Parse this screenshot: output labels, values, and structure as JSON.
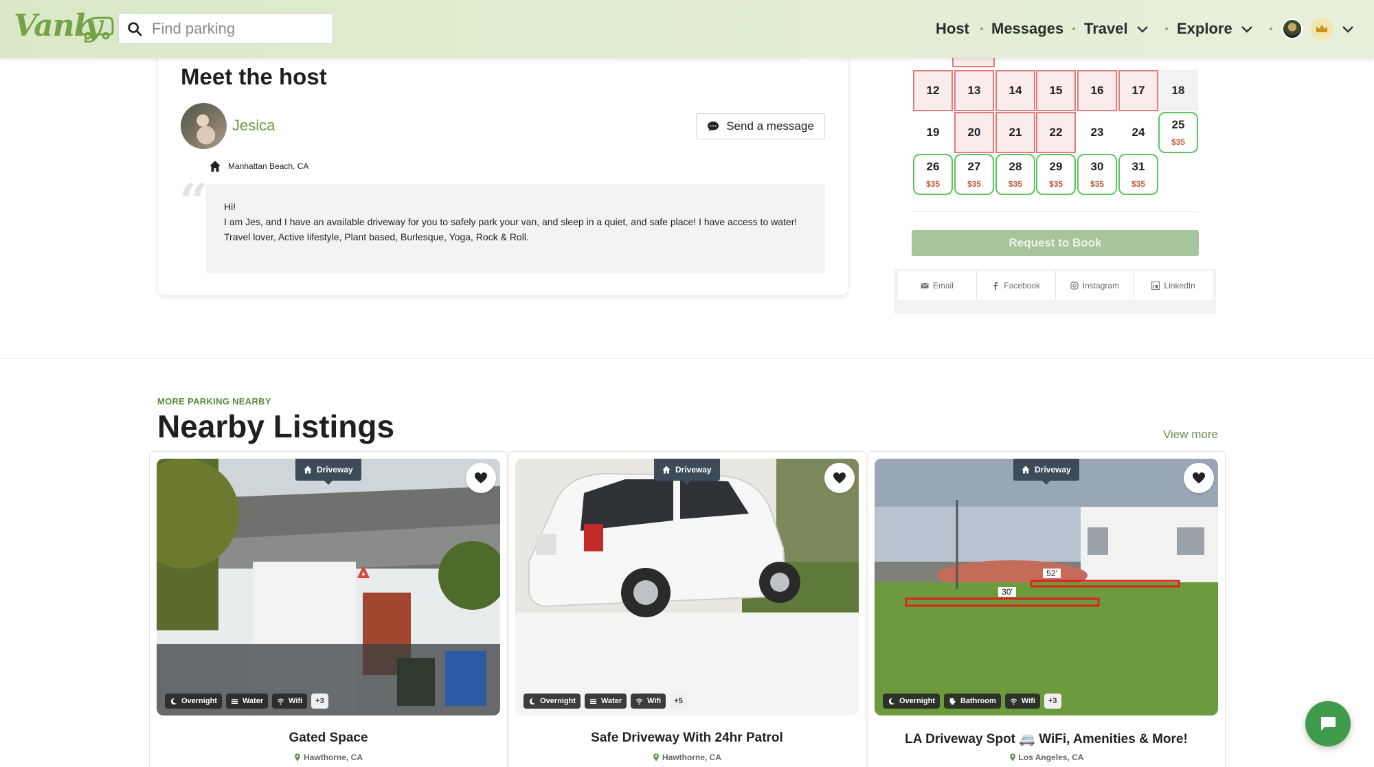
{
  "header": {
    "logo_text": "Vanly",
    "search_placeholder": "Find parking",
    "nav": {
      "host": "Host",
      "messages": "Messages",
      "travel": "Travel",
      "explore": "Explore"
    }
  },
  "host": {
    "title": "Meet the host",
    "name": "Jesica",
    "send_message": "Send a message",
    "location": "Manhattan Beach, CA",
    "bio": [
      "Hi!",
      "I am Jes, and I have an available driveway for you to safely park your van, and sleep in a quiet, and safe place! I have access to water!",
      "Travel lover, Active lifestyle, Plant based, Burlesque, Yoga, Rock & Roll."
    ]
  },
  "calendar": {
    "rows": [
      [
        {
          "d": "12",
          "s": "booked"
        },
        {
          "d": "13",
          "s": "booked"
        },
        {
          "d": "14",
          "s": "booked"
        },
        {
          "d": "15",
          "s": "booked"
        },
        {
          "d": "16",
          "s": "booked"
        },
        {
          "d": "17",
          "s": "booked"
        },
        {
          "d": "18",
          "s": "plain"
        }
      ],
      [
        {
          "d": "19",
          "s": "plainw"
        },
        {
          "d": "20",
          "s": "booked"
        },
        {
          "d": "21",
          "s": "booked"
        },
        {
          "d": "22",
          "s": "booked"
        },
        {
          "d": "23",
          "s": "plainw"
        },
        {
          "d": "24",
          "s": "plainw"
        },
        {
          "d": "25",
          "s": "avail",
          "p": "$35"
        }
      ],
      [
        {
          "d": "26",
          "s": "avail",
          "p": "$35"
        },
        {
          "d": "27",
          "s": "avail",
          "p": "$35"
        },
        {
          "d": "28",
          "s": "avail",
          "p": "$35"
        },
        {
          "d": "29",
          "s": "avail",
          "p": "$35"
        },
        {
          "d": "30",
          "s": "avail",
          "p": "$35"
        },
        {
          "d": "31",
          "s": "avail",
          "p": "$35"
        }
      ]
    ],
    "request_label": "Request to Book",
    "share": [
      "Email",
      "Facebook",
      "Instagram",
      "LinkedIn"
    ]
  },
  "nearby": {
    "eyebrow": "MORE PARKING NEARBY",
    "title": "Nearby Listings",
    "view_more": "View more",
    "listings": [
      {
        "type": "Driveway",
        "title": "Gated Space",
        "location": "Hawthorne, CA",
        "amenities": [
          "Overnight",
          "Water",
          "Wifi"
        ],
        "more": "+3"
      },
      {
        "type": "Driveway",
        "title": "Safe Driveway With 24hr Patrol",
        "location": "Hawthorne, CA",
        "amenities": [
          "Overnight",
          "Water",
          "Wifi"
        ],
        "more": "+5"
      },
      {
        "type": "Driveway",
        "title": "LA Driveway Spot 🚐 WiFi, Amenities & More!",
        "location": "Los Angeles, CA",
        "amenities": [
          "Overnight",
          "Bathroom",
          "Wifi"
        ],
        "more": "+3",
        "measure_labels": [
          "52'",
          "30'"
        ]
      }
    ]
  }
}
